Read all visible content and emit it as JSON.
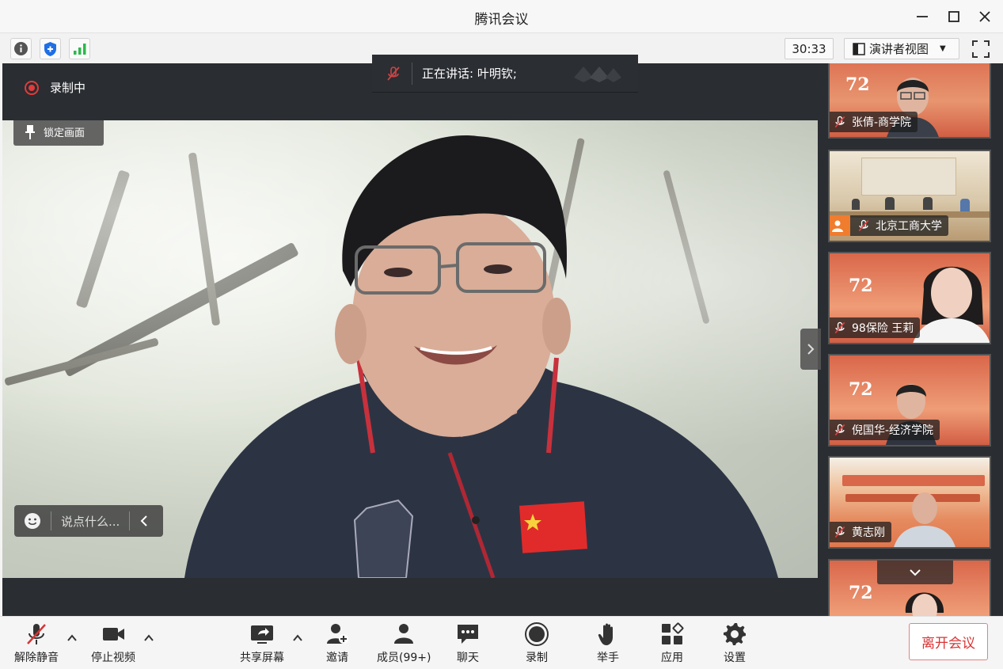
{
  "window": {
    "title": "腾讯会议"
  },
  "statusbar": {
    "timer": "30:33",
    "view_label": "演讲者视图"
  },
  "stage": {
    "recording_label": "录制中",
    "lock_label": "锁定画面",
    "speaking_text": "正在讲话: 叶明钦;",
    "chat_placeholder": "说点什么..."
  },
  "participants": [
    {
      "name": "张倩-商学院"
    },
    {
      "name": "北京工商大学"
    },
    {
      "name": "98保险 王莉"
    },
    {
      "name": "倪国华-经济学院"
    },
    {
      "name": "黄志刚"
    },
    {
      "name": ""
    }
  ],
  "toolbar": {
    "unmute": "解除静音",
    "stop_video": "停止视频",
    "share_screen": "共享屏幕",
    "invite": "邀请",
    "members": "成员(99+)",
    "chat": "聊天",
    "record": "录制",
    "raise_hand": "举手",
    "apps": "应用",
    "settings": "设置",
    "leave": "离开会议"
  },
  "colors": {
    "accent_red": "#d93434",
    "stage_bg": "#2a2d31",
    "signal_green": "#2db84d",
    "shield_blue": "#1f6fe5"
  }
}
